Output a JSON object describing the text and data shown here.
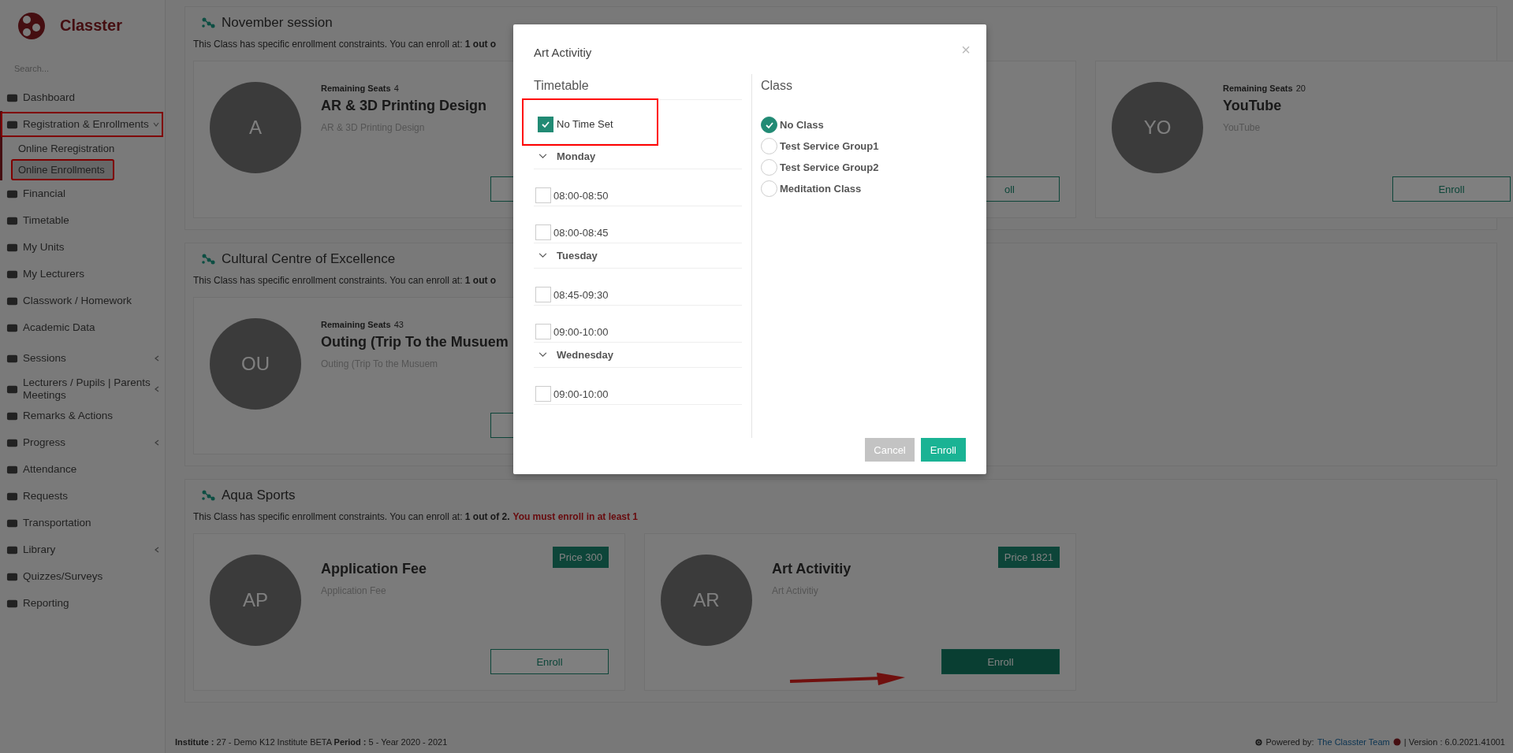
{
  "app": {
    "name": "Classter",
    "search_placeholder": "Search..."
  },
  "sidebar": {
    "items": [
      {
        "label": "Dashboard",
        "expandable": false,
        "highlighted": false,
        "expanded": false
      },
      {
        "label": "Registration & Enrollments",
        "expandable": true,
        "highlighted": true,
        "expanded": true,
        "children": [
          {
            "label": "Online Reregistration",
            "selected": false,
            "highlighted": false
          },
          {
            "label": "Online Enrollments",
            "selected": true,
            "highlighted": true
          }
        ]
      },
      {
        "label": "Financial",
        "expandable": false,
        "highlighted": false,
        "expanded": false
      },
      {
        "label": "Timetable",
        "expandable": false,
        "highlighted": false,
        "expanded": false
      },
      {
        "label": "My Units",
        "expandable": false,
        "highlighted": false,
        "expanded": false
      },
      {
        "label": "My Lecturers",
        "expandable": false,
        "highlighted": false,
        "expanded": false
      },
      {
        "label": "Classwork / Homework",
        "expandable": false,
        "highlighted": false,
        "expanded": false
      },
      {
        "label": "Academic Data",
        "expandable": false,
        "highlighted": false,
        "expanded": false
      },
      {
        "label": "Sessions",
        "expandable": true,
        "highlighted": false,
        "expanded": false
      },
      {
        "label": "Lecturers / Pupils | Parents Meetings",
        "expandable": true,
        "highlighted": false,
        "expanded": false
      },
      {
        "label": "Remarks & Actions",
        "expandable": false,
        "highlighted": false,
        "expanded": false
      },
      {
        "label": "Progress",
        "expandable": true,
        "highlighted": false,
        "expanded": false
      },
      {
        "label": "Attendance",
        "expandable": false,
        "highlighted": false,
        "expanded": false
      },
      {
        "label": "Requests",
        "expandable": false,
        "highlighted": false,
        "expanded": false
      },
      {
        "label": "Transportation",
        "expandable": false,
        "highlighted": false,
        "expanded": false
      },
      {
        "label": "Library",
        "expandable": true,
        "highlighted": false,
        "expanded": false
      },
      {
        "label": "Quizzes/Surveys",
        "expandable": false,
        "highlighted": false,
        "expanded": false
      },
      {
        "label": "Reporting",
        "expandable": false,
        "highlighted": false,
        "expanded": false
      }
    ]
  },
  "sections": [
    {
      "title": "November session",
      "constraint": "This Class has specific enrollment constraints. You can enroll at:",
      "count": "1 out o",
      "cards": [
        {
          "kind": "full",
          "avatar": "A",
          "seats_label": "Remaining Seats",
          "seats": "4",
          "title": "AR & 3D Printing Design",
          "subtitle": "AR & 3D Printing Design",
          "enroll": {
            "primary": false
          }
        },
        {
          "kind": "covered",
          "enroll": {
            "label": "oll",
            "primary": false
          }
        },
        {
          "kind": "full",
          "avatar": "YO",
          "seats_label": "Remaining Seats",
          "seats": "20",
          "title": "YouTube",
          "subtitle": "YouTube",
          "enroll": {
            "label": "Enroll",
            "primary": false
          }
        }
      ]
    },
    {
      "title": "Cultural Centre of Excellence",
      "constraint": "This Class has specific enrollment constraints. You can enroll at:",
      "count": "1 out o",
      "cards": [
        {
          "kind": "full",
          "avatar": "OU",
          "seats_label": "Remaining Seats",
          "seats": "43",
          "title": "Outing (Trip To the Musuem",
          "subtitle": "Outing (Trip To the Musuem",
          "enroll": {
            "primary": false
          }
        }
      ]
    },
    {
      "title": "Aqua Sports",
      "constraint": "This Class has specific enrollment constraints. You can enroll at:",
      "count": "1 out of 2.",
      "warning": "You must enroll in at least 1",
      "cards": [
        {
          "kind": "full",
          "avatar": "AP",
          "title": "Application Fee",
          "subtitle": "Application Fee",
          "price": "Price 300",
          "enroll": {
            "label": "Enroll",
            "primary": false
          }
        },
        {
          "kind": "full",
          "avatar": "AR",
          "title": "Art Activitiy",
          "subtitle": "Art Activitiy",
          "price": "Price 1821",
          "enroll": {
            "label": "Enroll",
            "primary": true
          }
        }
      ]
    }
  ],
  "footer": {
    "institute_label": "Institute :",
    "institute": "27 - Demo K12 Institute BETA",
    "period_label": "Period :",
    "period": "5 - Year 2020 - 2021",
    "powered_by": "Powered by:",
    "team_link": "The Classter Team",
    "version": "| Version : 6.0.2021.41001"
  },
  "modal": {
    "title": "Art Activitiy",
    "close": "×",
    "timetable": {
      "heading": "Timetable",
      "no_time": {
        "label": "No Time Set",
        "checked": true,
        "highlighted": true
      },
      "days": [
        {
          "name": "Monday",
          "expanded": true,
          "slots": [
            {
              "time": "08:00-08:50",
              "checked": false
            },
            {
              "time": "08:00-08:45",
              "checked": false
            }
          ]
        },
        {
          "name": "Tuesday",
          "expanded": true,
          "slots": [
            {
              "time": "08:45-09:30",
              "checked": false
            },
            {
              "time": "09:00-10:00",
              "checked": false
            }
          ]
        },
        {
          "name": "Wednesday",
          "expanded": true,
          "slots": [
            {
              "time": "09:00-10:00",
              "checked": false
            }
          ]
        }
      ]
    },
    "class": {
      "heading": "Class",
      "options": [
        {
          "label": "No Class",
          "selected": true
        },
        {
          "label": "Test Service Group1",
          "selected": false
        },
        {
          "label": "Test Service Group2",
          "selected": false
        },
        {
          "label": "Meditation Class",
          "selected": false
        }
      ]
    },
    "buttons": [
      {
        "label": "Cancel",
        "kind": "secondary"
      },
      {
        "label": "Enroll",
        "kind": "primary"
      }
    ]
  }
}
